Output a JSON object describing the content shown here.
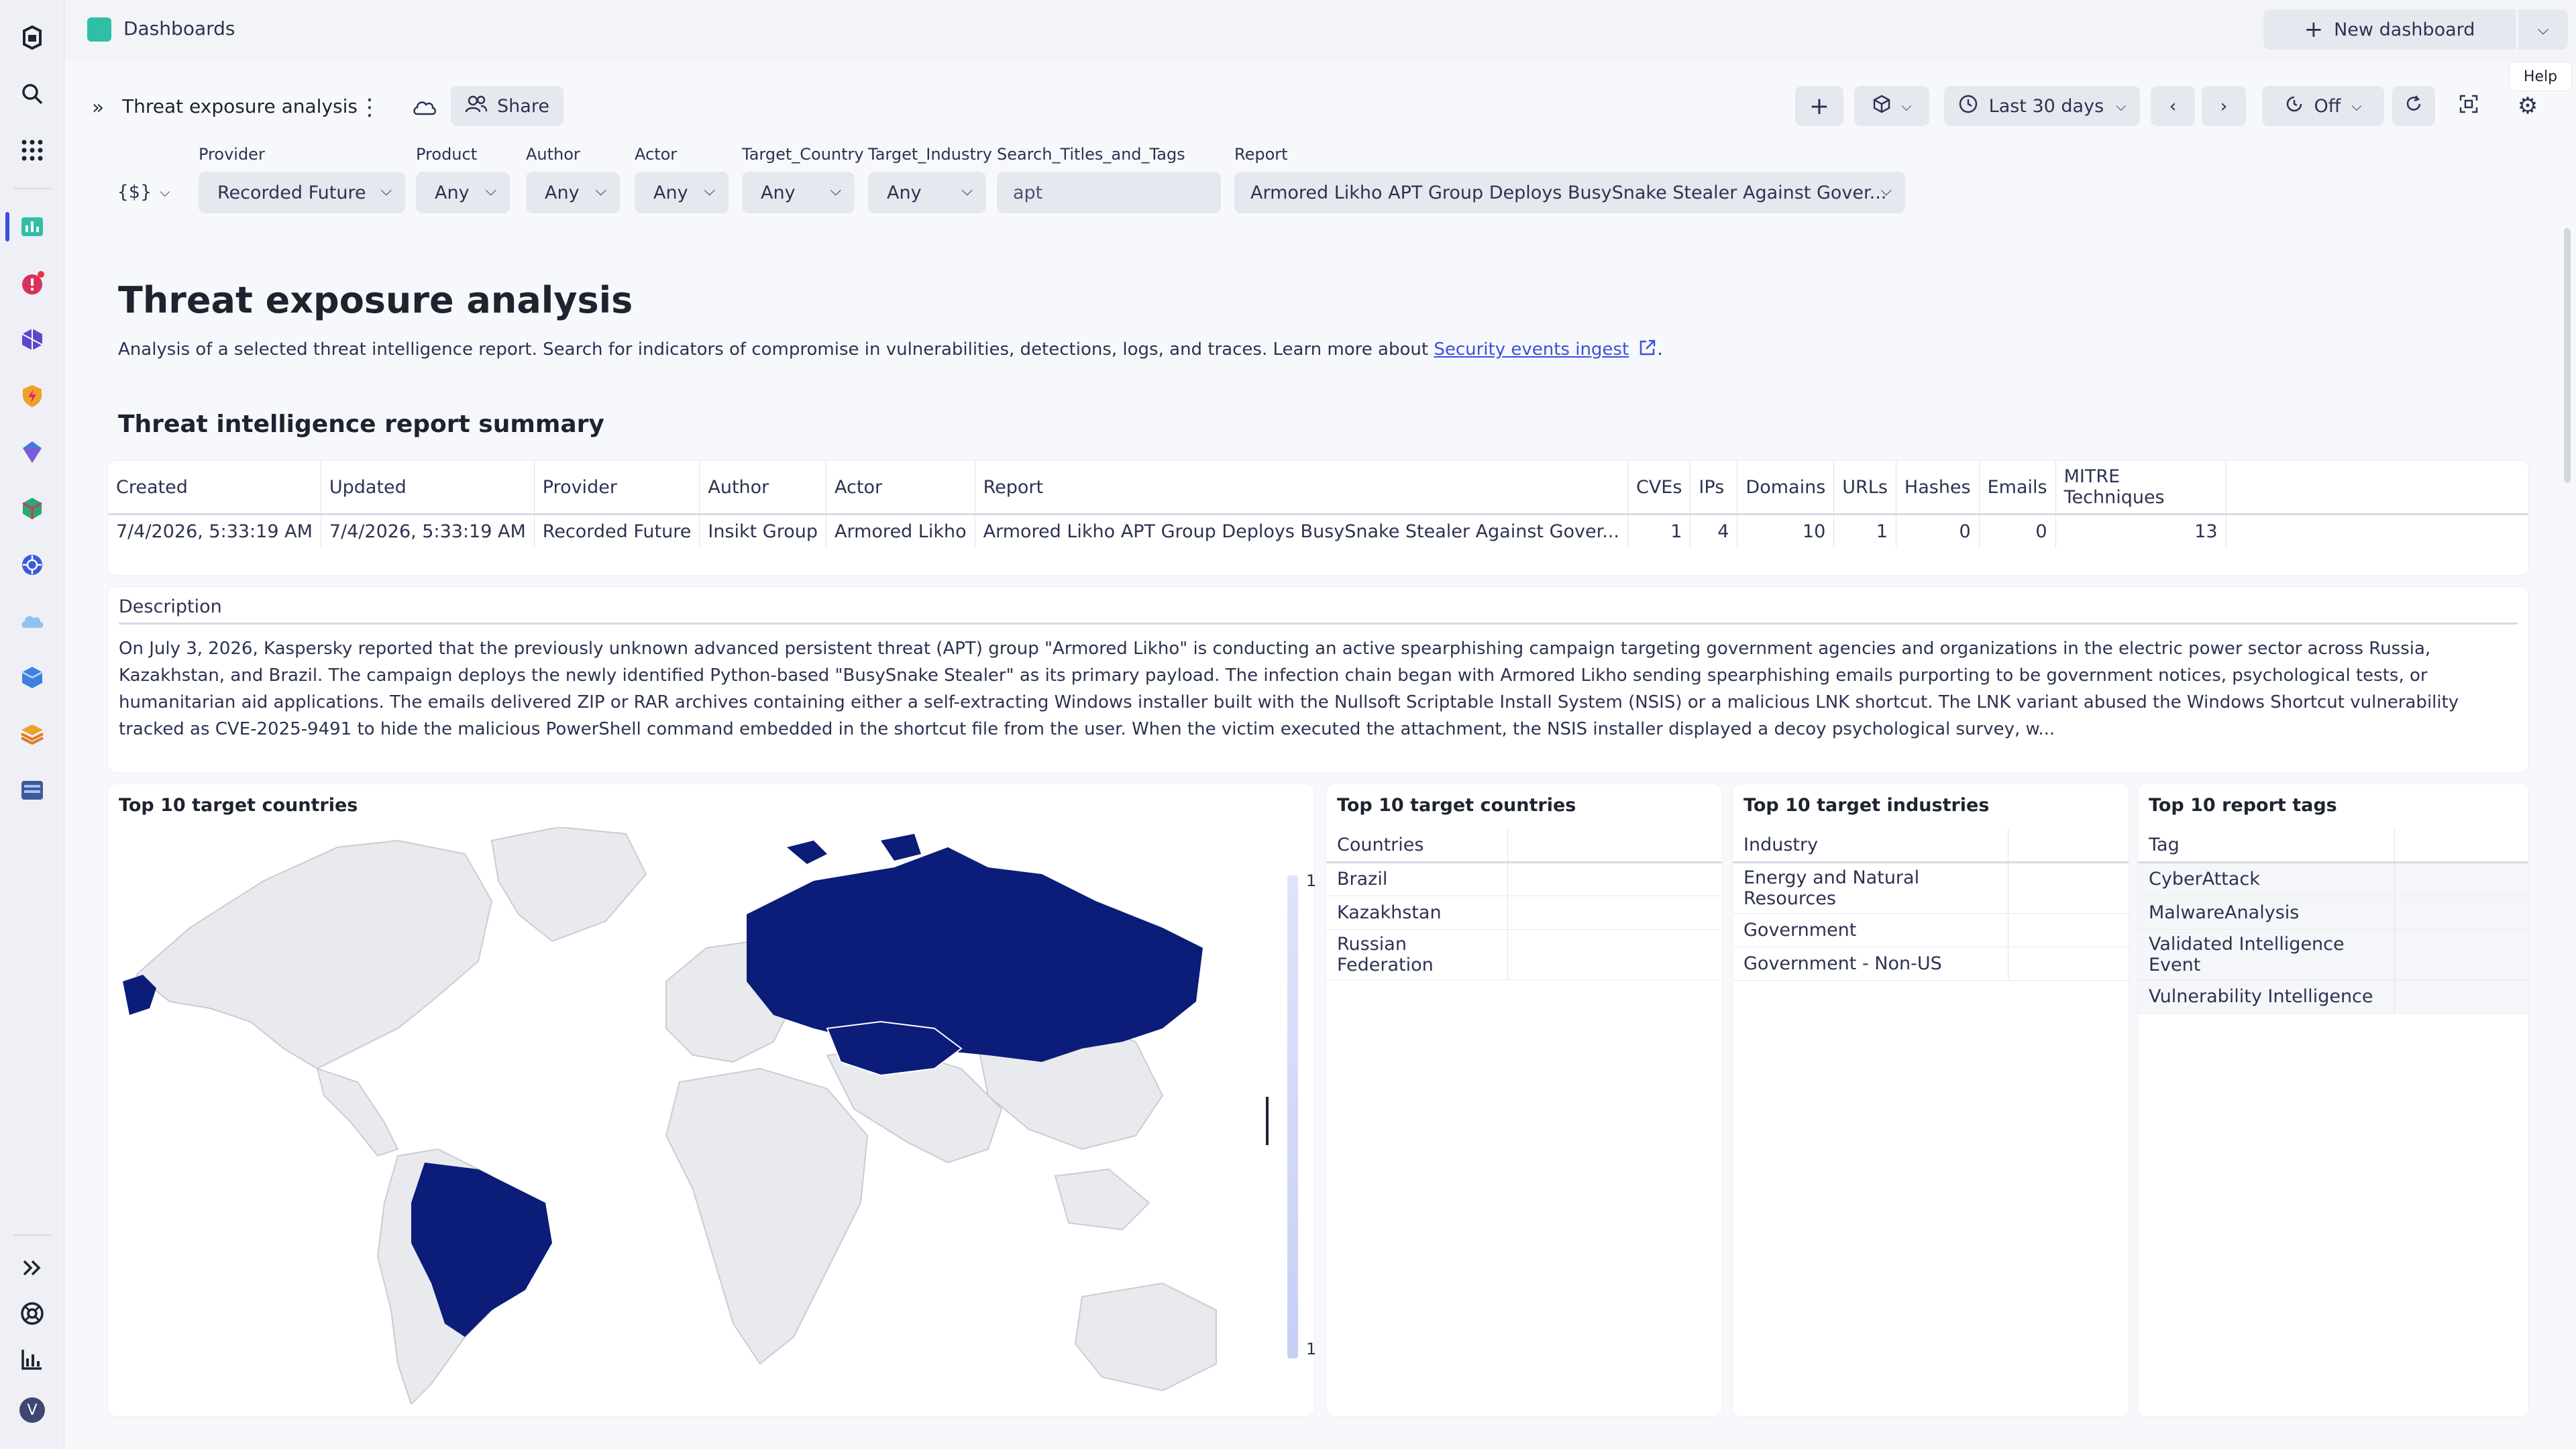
{
  "app": {
    "title": "Dashboards"
  },
  "topbar": {
    "new_dashboard": "New dashboard",
    "help_tooltip": "Help"
  },
  "toolbar": {
    "dashboard_name": "Threat exposure analysis",
    "share": "Share",
    "timeframe": "Last 30 days",
    "refresh": "Off"
  },
  "filters": {
    "variable_toggle": "{$}",
    "provider": {
      "label": "Provider",
      "value": "Recorded Future"
    },
    "product": {
      "label": "Product",
      "value": "Any"
    },
    "author": {
      "label": "Author",
      "value": "Any"
    },
    "actor": {
      "label": "Actor",
      "value": "Any"
    },
    "target_country": {
      "label": "Target_Country",
      "value": "Any"
    },
    "target_industry": {
      "label": "Target_Industry",
      "value": "Any"
    },
    "search": {
      "label": "Search_Titles_and_Tags",
      "value": "apt"
    },
    "report": {
      "label": "Report",
      "value": "Armored Likho APT Group Deploys BusySnake Stealer Against Gover..."
    }
  },
  "page": {
    "title": "Threat exposure analysis",
    "description": "Analysis of a selected threat intelligence report. Search for indicators of compromise in vulnerabilities, detections, logs, and traces. Learn more about ",
    "link": "Security events ingest",
    "description_end": "."
  },
  "summary": {
    "title": "Threat intelligence report summary",
    "columns": [
      "Created",
      "Updated",
      "Provider",
      "Author",
      "Actor",
      "Report",
      "CVEs",
      "IPs",
      "Domains",
      "URLs",
      "Hashes",
      "Emails",
      "MITRE Techniques"
    ],
    "row": {
      "created": "7/4/2026, 5:33:19 AM",
      "updated": "7/4/2026, 5:33:19 AM",
      "provider": "Recorded Future",
      "author": "Insikt Group",
      "actor": "Armored Likho",
      "report": "Armored Likho APT Group Deploys BusySnake Stealer Against Gover...",
      "cves": "1",
      "ips": "4",
      "domains": "10",
      "urls": "1",
      "hashes": "0",
      "emails": "0",
      "mitre": "13"
    }
  },
  "description_card": {
    "header": "Description",
    "text": "On July 3, 2026, Kaspersky reported that the previously unknown advanced persistent threat (APT) group \"Armored Likho\" is conducting an active spearphishing campaign targeting government agencies and organizations in the electric power sector across Russia, Kazakhstan, and Brazil. The campaign deploys the newly identified Python-based \"BusySnake Stealer\" as its primary payload. The infection chain began with Armored Likho sending spearphishing emails purporting to be government notices, psychological tests, or humanitarian aid applications. The emails delivered ZIP or RAR archives containing either a self-extracting Windows installer built with the Nullsoft Scriptable Install System (NSIS) or a malicious LNK shortcut. The LNK variant abused the Windows Shortcut vulnerability tracked as CVE-2025-9491 to hide the malicious PowerShell command embedded in the shortcut file from the user. When the victim executed the attachment, the NSIS installer displayed a decoy psychological survey, w..."
  },
  "map_card": {
    "title": "Top 10 target countries",
    "legend_max": "1",
    "legend_min": "1",
    "highlight_color": "#0b1d78"
  },
  "countries_card": {
    "title": "Top 10 target countries",
    "header": "Countries",
    "items": [
      "Brazil",
      "Kazakhstan",
      "Russian Federation"
    ]
  },
  "industries_card": {
    "title": "Top 10 target industries",
    "header": "Industry",
    "items": [
      "Energy and Natural Resources",
      "Government",
      "Government - Non-US"
    ]
  },
  "tags_card": {
    "title": "Top 10 report tags",
    "header": "Tag",
    "items": [
      "CyberAttack",
      "MalwareAnalysis",
      "Validated Intelligence Event",
      "Vulnerability Intelligence"
    ]
  },
  "user": {
    "avatar_initial": "V"
  }
}
